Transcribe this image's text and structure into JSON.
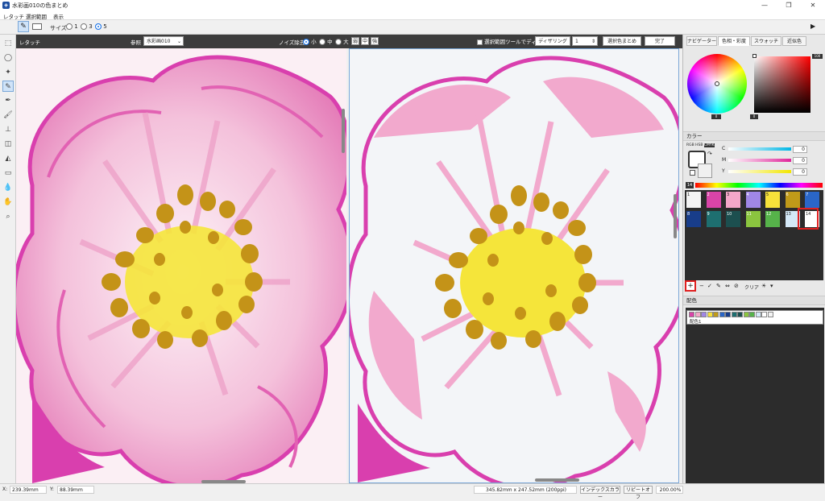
{
  "window": {
    "title": "水彩画010の色まとめ",
    "minimize": "—",
    "maximize": "❐",
    "close": "✕"
  },
  "menu": [
    "レタッチ",
    "選択範囲",
    "表示"
  ],
  "toolbar": {
    "size_label": "サイズ",
    "size_options": [
      "1",
      "3",
      "5"
    ],
    "size_selected": "5"
  },
  "retouch": {
    "title": "レタッチ",
    "ref_label": "参照",
    "ref_value": "水彩画010",
    "noise_label": "ノイズ除去",
    "noise_options": [
      "小",
      "中",
      "大"
    ],
    "noise_selected": "小",
    "mini_buttons": [
      "弱",
      "中",
      "強"
    ],
    "checkbox_label": "選択範囲ツールでディザ",
    "dither_button": "ディザリング",
    "dither_value": "1",
    "select_merge_button": "選択色まとめ",
    "done_button": "完了"
  },
  "panel": {
    "tabs": [
      "ナビゲーター",
      "色相・彩度",
      "スウォッチ",
      "近似色"
    ],
    "active_tab": "色相・彩度",
    "hue_value": "0",
    "sat_value": "100",
    "val_value": "0",
    "color_section": "カラー",
    "color_mode_tabs": [
      "RGB",
      "HSB",
      "CMYK"
    ],
    "cmy": [
      {
        "label": "C",
        "value": "0"
      },
      {
        "label": "M",
        "value": "0"
      },
      {
        "label": "Y",
        "value": "0"
      }
    ],
    "palette_number": "14",
    "swatches": [
      {
        "n": "1",
        "color": "#f3f3f3"
      },
      {
        "n": "2",
        "color": "#d944a8"
      },
      {
        "n": "3",
        "color": "#f4a7c9"
      },
      {
        "n": "4",
        "color": "#a087e6"
      },
      {
        "n": "5",
        "color": "#f7e13a"
      },
      {
        "n": "6",
        "color": "#c09a19"
      },
      {
        "n": "7",
        "color": "#2a66c8"
      },
      {
        "n": "8",
        "color": "#183d8a"
      },
      {
        "n": "9",
        "color": "#1e6f70"
      },
      {
        "n": "10",
        "color": "#1c4f4f"
      },
      {
        "n": "11",
        "color": "#8bc53f"
      },
      {
        "n": "12",
        "color": "#56b34a"
      },
      {
        "n": "13",
        "color": "#d4e8f7"
      },
      {
        "n": "14",
        "color": "#ffffff"
      }
    ],
    "swatch_actions": [
      "+",
      "−",
      "✓",
      "✎",
      "⇔",
      "⊘",
      "クリア",
      "☀",
      "▾"
    ],
    "haishoku_section": "配色",
    "haishoku_item": "配色1",
    "haishoku_colors": [
      "#d944a8",
      "#f4a7c9",
      "#a087e6",
      "#f7e13a",
      "#c09a19",
      "#2a66c8",
      "#183d8a",
      "#1e6f70",
      "#1c4f4f",
      "#8bc53f",
      "#56b34a",
      "#d4e8f7",
      "#ffffff",
      "#f3f3f3"
    ],
    "bottom_actions": [
      "+",
      "−",
      "⇡",
      "⇣",
      "▾"
    ]
  },
  "status": {
    "x_label": "X:",
    "x_value": "239.39mm",
    "y_label": "Y:",
    "y_value": "88.39mm",
    "doc_size": "345.82mm x 247.52mm (200ppi)",
    "index_color": "インデックスカラー",
    "repeat_off": "リピートオフ",
    "zoom": "200.00%"
  },
  "colors": {
    "pink_dark": "#d93fae",
    "pink_light": "#f2a9cd",
    "gold": "#c49318",
    "yellow": "#f5e53a"
  }
}
